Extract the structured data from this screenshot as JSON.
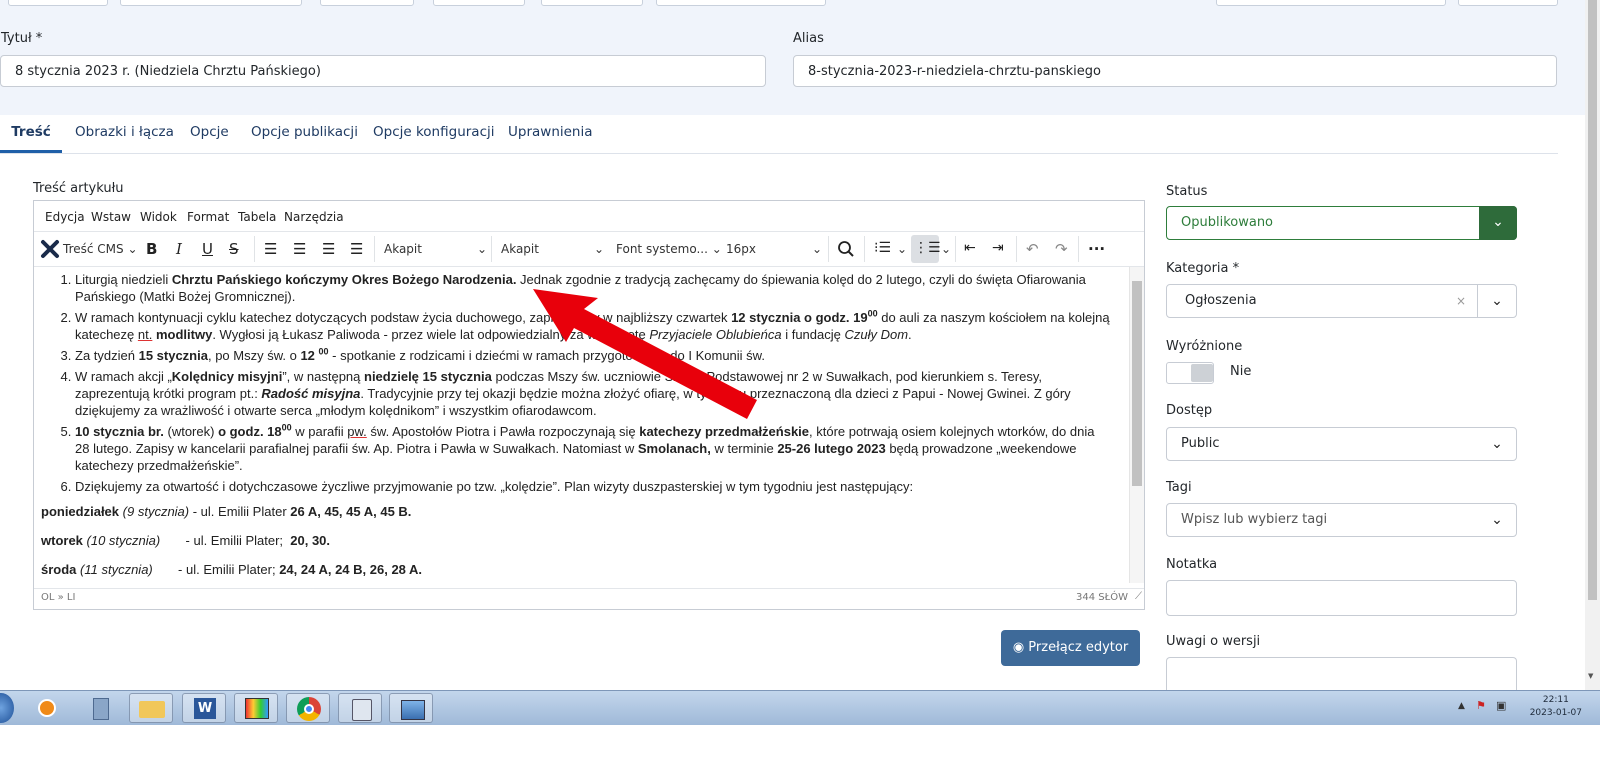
{
  "fields": {
    "title_label": "Tytuł *",
    "title_value": "8 stycznia 2023 r. (Niedziela Chrztu Pańskiego)",
    "alias_label": "Alias",
    "alias_value": "8-stycznia-2023-r-niedziela-chrztu-panskiego"
  },
  "tabs": [
    {
      "label": "Treść"
    },
    {
      "label": "Obrazki i łącza"
    },
    {
      "label": "Opcje"
    },
    {
      "label": "Opcje publikacji"
    },
    {
      "label": "Opcje konfiguracji"
    },
    {
      "label": "Uprawnienia"
    }
  ],
  "editor": {
    "label": "Treść artykułu",
    "menu": [
      "Edycja",
      "Wstaw",
      "Widok",
      "Format",
      "Tabela",
      "Narzędzia"
    ],
    "toolbar": {
      "cms_label": "Treść CMS",
      "paragraph_select": "Akapit",
      "format_select": "Akapit",
      "font_select": "Font systemo...",
      "size_select": "16px"
    },
    "status_path": "OL » LI",
    "word_count": "344 SŁÓW"
  },
  "content": {
    "item1_bold": "Chrztu Pańskiego kończymy Okres Bożego Narodzenia.",
    "item1_a": "Liturgią niedzieli ",
    "item1_b": " Jednak zgodnie z tradycją zachęcamy do śpiewania kolęd do 2 lutego, czyli do święta Ofiarowania Pańskiego (Matki Bożej Gromnicznej).",
    "item2_a": "W ramach kontynuacji cyklu katechez dotyczących podstaw życia duchowego, zapraszamy w najbliższy czwartek ",
    "item2_bold": "12 stycznia o godz. 19",
    "item2_sup": "00",
    "item2_b": " do auli za naszym kościołem na kolejną katechezę ",
    "item2_nt": "nt.",
    "item2_bold2": "modlitwy",
    "item2_c": ". Wygłosi ją Łukasz Paliwoda - przez wiele lat odpowiedzialny za wspólnotę ",
    "item2_i1": "Przyjaciele Oblubieńca",
    "item2_d": " i fundację ",
    "item2_i2": "Czuły Dom",
    "item2_e": ".",
    "item3_a": "Za tydzień ",
    "item3_bold": "15 stycznia",
    "item3_b": ", po Mszy św. o ",
    "item3_bold2": "12",
    "item3_sup": "00",
    "item3_c": " - spotkanie z rodzicami i dziećmi w ramach przygotowania do I Komunii św.",
    "item4_a": "W ramach akcji „",
    "item4_bold": "Kolędnicy misyjni",
    "item4_b": "”, w następną ",
    "item4_bold2": "niedzielę 15 stycznia",
    "item4_c": " podczas Mszy św. uczniowie Szkoły Podstawowej nr 2 w Suwałkach, pod kierunkiem s. Teresy, zaprezentują krótki program pt.: ",
    "item4_bi": "Radość misyjna",
    "item4_d": ". Tradycyjnie przy tej okazji będzie można złożyć ofiarę, w tym roku przeznaczoną dla dzieci z Papui - Nowej Gwinei. Z góry dziękujemy za wrażliwość i otwarte serca „młodym kolędnikom” i wszystkim ofiarodawcom.",
    "item5_bold": "10 stycznia br.",
    "item5_a": " (wtorek) ",
    "item5_bold2": "o godz. 18",
    "item5_sup": "00",
    "item5_b": " w parafii ",
    "item5_pw": "pw.",
    "item5_c": " św. Apostołów Piotra i Pawła rozpoczynają się ",
    "item5_bold3": "katechezy przedmałżeńskie",
    "item5_d": ", które potrwają osiem kolejnych wtorków, do dnia 28 lutego. Zapisy w kancelarii parafialnej parafii św. Ap. Piotra i Pawła w Suwałkach. Natomiast w ",
    "item5_bold4": "Smolanach,",
    "item5_e": " w terminie ",
    "item5_bold5": "25-26 lutego 2023",
    "item5_f": " będą prowadzone „weekendowe katechezy przedmałżeńskie”.",
    "item6": "Dziękujemy za otwartość i dotychczasowe życzliwe przyjmowanie po tzw. „kolędzie”. Plan wizyty duszpasterskiej w tym tygodniu jest następujący:",
    "day1_bold": "poniedziałek",
    "day1_i": "(9 stycznia)",
    "day1_a": " - ul. Emilii Plater ",
    "day1_bold2": "26 A, 45, 45 A, 45 B.",
    "day2_bold": "wtorek",
    "day2_i": "(10 stycznia)",
    "day2_a": "       - ul. Emilii Plater;  ",
    "day2_bold2": "20, 30.",
    "day3_bold": "środa",
    "day3_i": "(11 stycznia)",
    "day3_a": "       - ul. Emilii Plater; ",
    "day3_bold2": "24, 24 A, 24 B, 26, 28 A."
  },
  "toggle_editor": "Przełącz edytor",
  "sidebar": {
    "status_label": "Status",
    "status_value": "Opublikowano",
    "category_label": "Kategoria *",
    "category_value": "Ogłoszenia",
    "featured_label": "Wyróżnione",
    "featured_value": "Nie",
    "access_label": "Dostęp",
    "access_value": "Public",
    "tags_label": "Tagi",
    "tags_placeholder": "Wpisz lub wybierz tagi",
    "note_label": "Notatka",
    "version_label": "Uwagi o wersji"
  },
  "taskbar": {
    "time": "22:11",
    "date": "2023-01-07"
  },
  "colors": {
    "accent": "#1f5fa8",
    "published": "#2e7d3b",
    "button": "#3e6a99",
    "arrow": "#e8000b"
  }
}
